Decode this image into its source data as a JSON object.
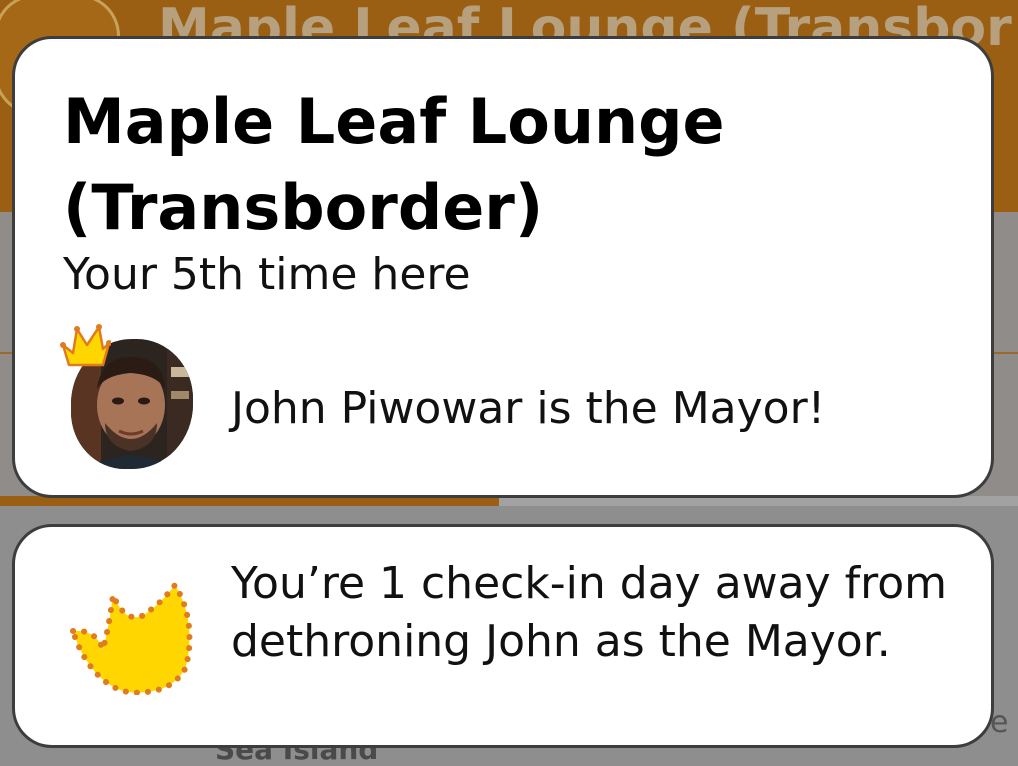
{
  "background": {
    "venue_title": "Maple Leaf Lounge (Transbor",
    "bottom_peek": "Sea Island",
    "right_peek": "e",
    "progress_fraction": 0.49
  },
  "venue_card": {
    "title": "Maple Leaf Lounge (Transborder)",
    "visit_count": "Your 5th time here",
    "mayor_status": "John Piwowar is the Mayor!"
  },
  "mayor_card": {
    "message": "You’re 1 check-in day away from dethroning John as the Mayor."
  },
  "colors": {
    "crown_fill": "#FFD600",
    "crown_dots": "#E07B1F",
    "card_border": "#3D3D3D",
    "header_brown": "#9A5F12"
  },
  "icons": {
    "mayor_badge": "crown-icon",
    "dethrone_badge": "crown-icon"
  }
}
